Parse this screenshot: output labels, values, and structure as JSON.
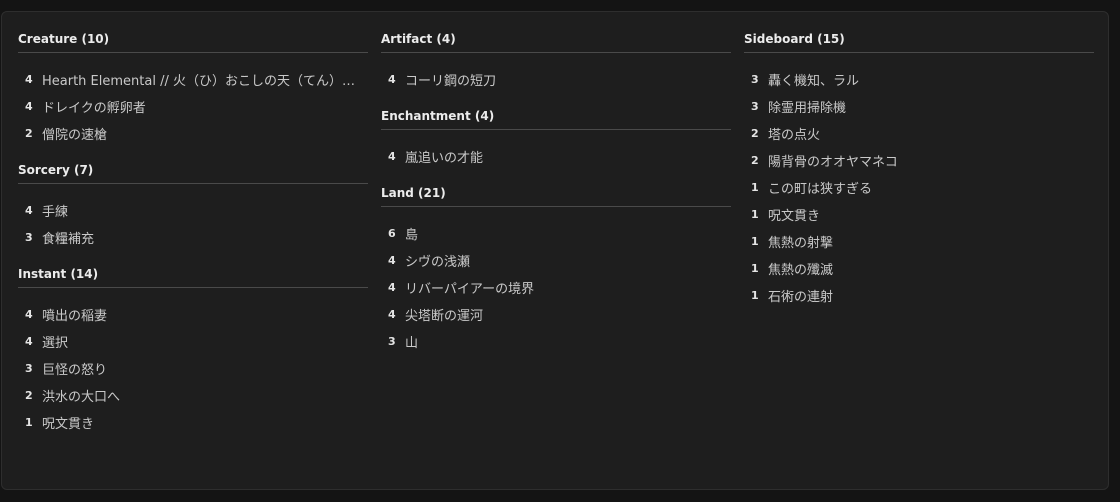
{
  "columns": [
    {
      "sections": [
        {
          "header": "Creature (10)",
          "cards": [
            {
              "qty": "4",
              "name": "Hearth Elemental // 火（ひ）おこしの天（てん）使（し）"
            },
            {
              "qty": "4",
              "name": "ドレイクの孵卵者"
            },
            {
              "qty": "2",
              "name": "僧院の速槍"
            }
          ]
        },
        {
          "header": "Sorcery (7)",
          "cards": [
            {
              "qty": "4",
              "name": "手練"
            },
            {
              "qty": "3",
              "name": "食糧補充"
            }
          ]
        },
        {
          "header": "Instant (14)",
          "cards": [
            {
              "qty": "4",
              "name": "噴出の稲妻"
            },
            {
              "qty": "4",
              "name": "選択"
            },
            {
              "qty": "3",
              "name": "巨怪の怒り"
            },
            {
              "qty": "2",
              "name": "洪水の大口へ"
            },
            {
              "qty": "1",
              "name": "呪文貫き"
            }
          ]
        }
      ]
    },
    {
      "sections": [
        {
          "header": "Artifact (4)",
          "cards": [
            {
              "qty": "4",
              "name": "コーリ鋼の短刀"
            }
          ]
        },
        {
          "header": "Enchantment (4)",
          "cards": [
            {
              "qty": "4",
              "name": "嵐追いの才能"
            }
          ]
        },
        {
          "header": "Land (21)",
          "cards": [
            {
              "qty": "6",
              "name": "島"
            },
            {
              "qty": "4",
              "name": "シヴの浅瀬"
            },
            {
              "qty": "4",
              "name": "リバーパイアーの境界"
            },
            {
              "qty": "4",
              "name": "尖塔断の運河"
            },
            {
              "qty": "3",
              "name": "山"
            }
          ]
        }
      ]
    },
    {
      "sections": [
        {
          "header": "Sideboard (15)",
          "cards": [
            {
              "qty": "3",
              "name": "轟く機知、ラル"
            },
            {
              "qty": "3",
              "name": "除霊用掃除機"
            },
            {
              "qty": "2",
              "name": "塔の点火"
            },
            {
              "qty": "2",
              "name": "陽背骨のオオヤマネコ"
            },
            {
              "qty": "1",
              "name": "この町は狭すぎる"
            },
            {
              "qty": "1",
              "name": "呪文貫き"
            },
            {
              "qty": "1",
              "name": "焦熱の射撃"
            },
            {
              "qty": "1",
              "name": "焦熱の殲滅"
            },
            {
              "qty": "1",
              "name": "石術の連射"
            }
          ]
        }
      ]
    }
  ]
}
